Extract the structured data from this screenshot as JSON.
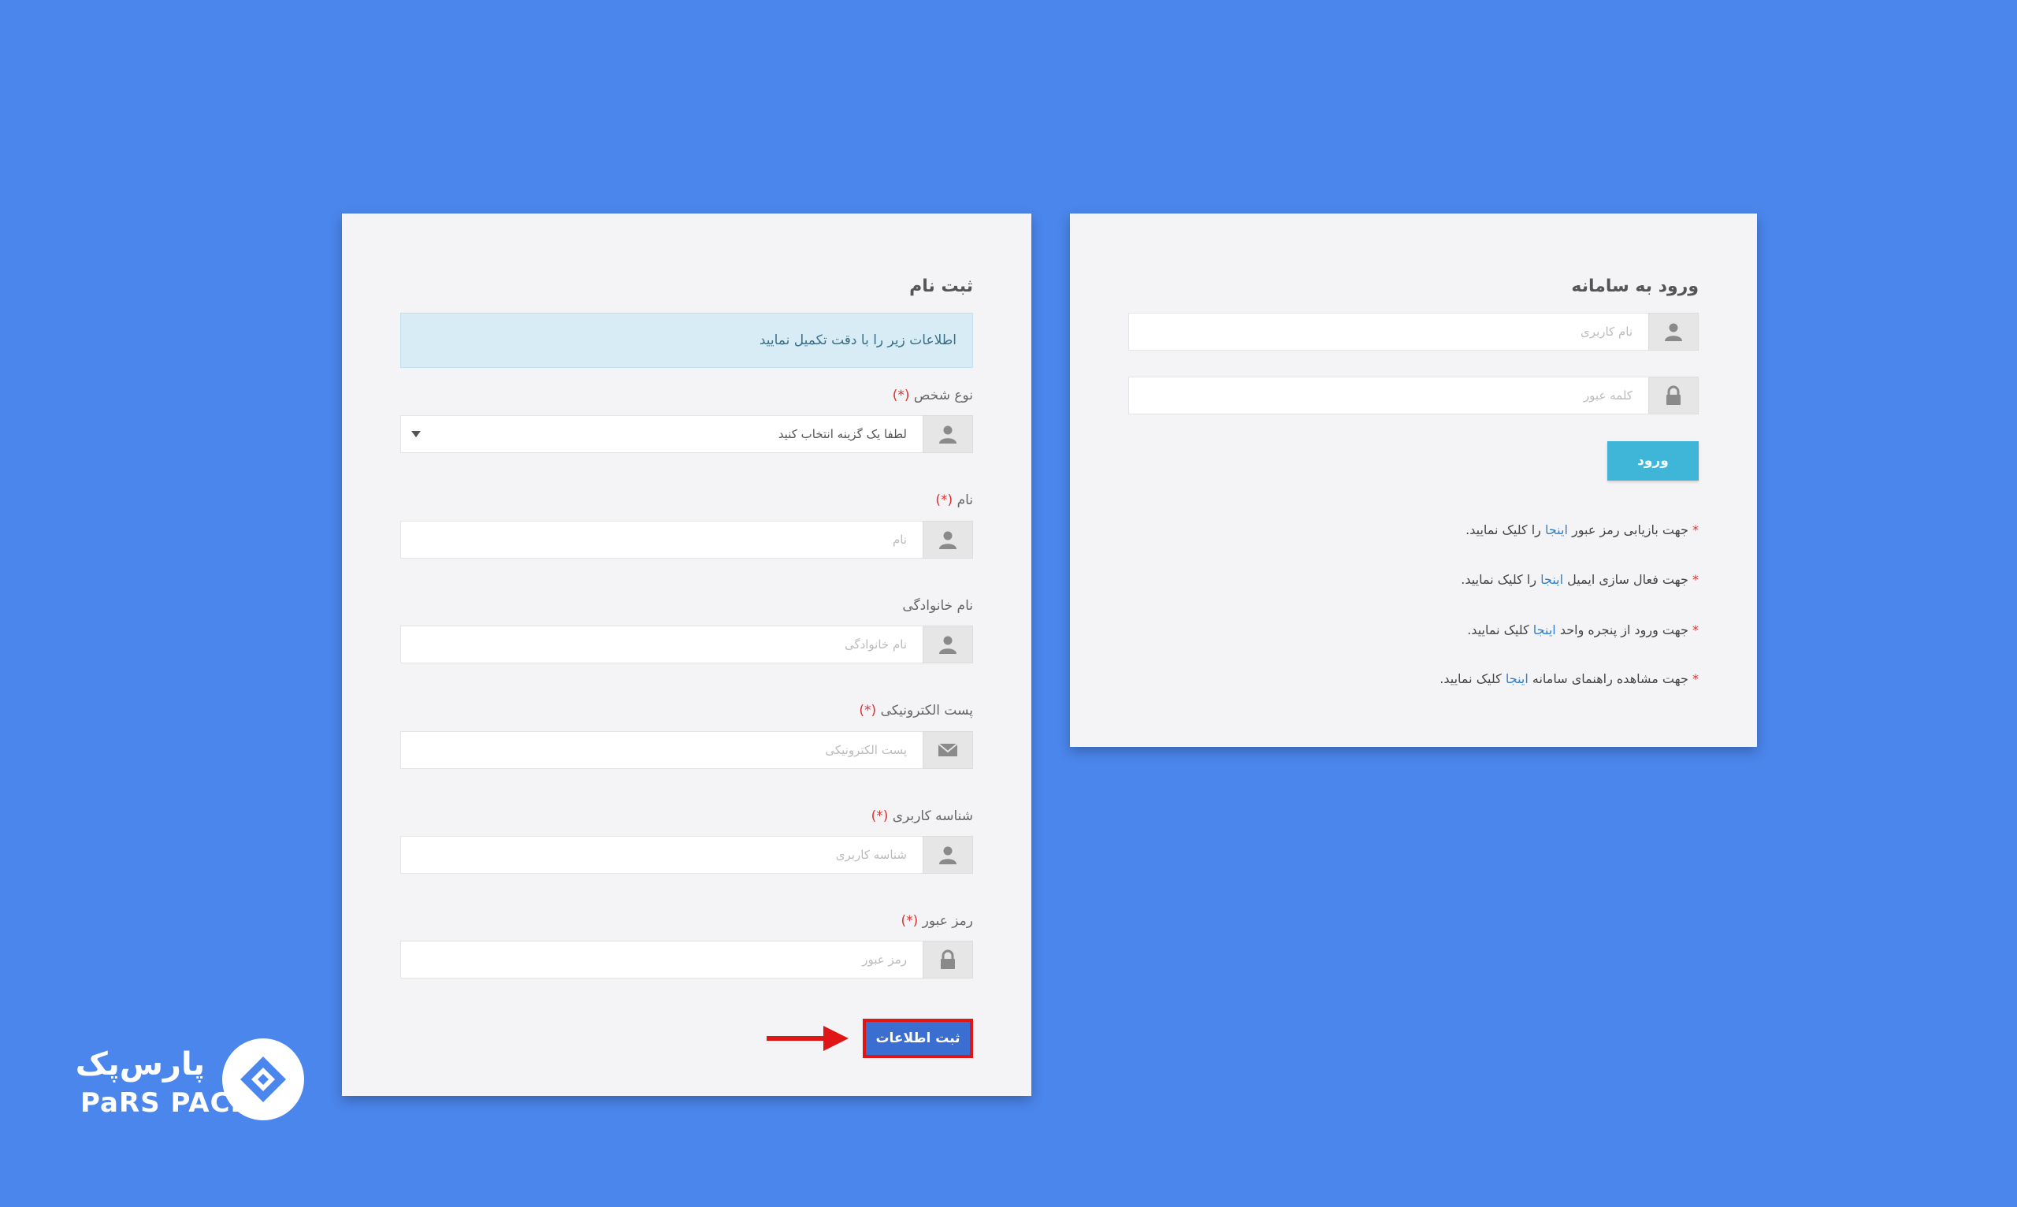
{
  "register": {
    "title": "ثبت نام",
    "notice": "اطلاعات زیر را با دقت تکمیل نمایید",
    "required_mark": "(*)",
    "fields": [
      {
        "label": "نوع شخص",
        "placeholder": "لطفا یک گزینه انتخاب کنید",
        "icon": "user-icon",
        "required": true,
        "type": "select"
      },
      {
        "label": "نام",
        "placeholder": "نام",
        "icon": "user-icon",
        "required": true
      },
      {
        "label": "نام خانوادگی",
        "placeholder": "نام خانوادگی",
        "icon": "user-icon",
        "required": false
      },
      {
        "label": "پست الکترونیکی",
        "placeholder": "پست الکترونیکی",
        "icon": "envelope-icon",
        "required": true
      },
      {
        "label": "شناسه کاربری",
        "placeholder": "شناسه کاربری",
        "icon": "user-icon",
        "required": true
      },
      {
        "label": "رمز عبور",
        "placeholder": "رمز عبور",
        "icon": "lock-icon",
        "required": true
      }
    ],
    "submit_label": "ثبت اطلاعات"
  },
  "login": {
    "title": "ورود به سامانه",
    "username_placeholder": "نام کاربری",
    "password_placeholder": "کلمه عبور",
    "submit_label": "ورود",
    "links": [
      {
        "before": "جهت بازیابی رمز عبور",
        "link": "اینجا",
        "after": "را کلیک نمایید."
      },
      {
        "before": "جهت فعال سازی ایمیل",
        "link": "اینجا",
        "after": "را کلیک نمایید."
      },
      {
        "before": "جهت ورود از پنجره واحد",
        "link": "اینجا",
        "after": "کلیک نمایید."
      },
      {
        "before": "جهت مشاهده راهنمای سامانه",
        "link": "اینجا",
        "after": "کلیک نمایید."
      }
    ],
    "bullet": "*"
  },
  "brand": {
    "name_fa": "پارس‌پک",
    "name_en": "PaRS PACK"
  },
  "colors": {
    "background": "#4b86ec",
    "panel": "#f4f4f6",
    "submit": "#3a6fd1",
    "highlight": "#e01616",
    "login_button": "#3fb5d8",
    "link": "#2f7fcf"
  }
}
